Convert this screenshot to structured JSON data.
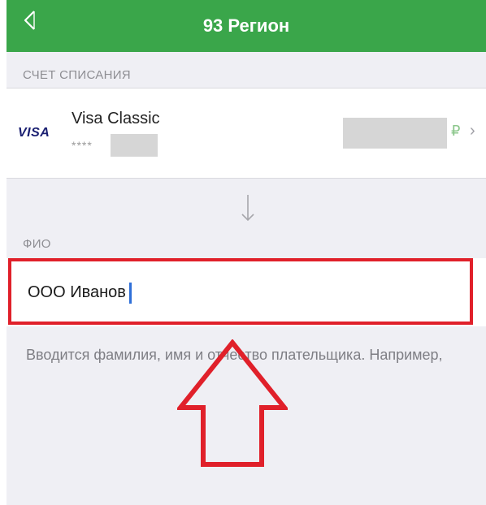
{
  "header": {
    "title": "93 Регион",
    "back_icon": "chevron-left-icon",
    "color": "#3aa64a"
  },
  "debit_section": {
    "label": "СЧЕТ СПИСАНИЯ",
    "card": {
      "brand": "VISA",
      "name": "Visa Classic",
      "mask": "****",
      "currency": "₽",
      "chevron": "›"
    }
  },
  "fio_section": {
    "label": "ФИО",
    "value": "ООО Иванов",
    "hint": "Вводится фамилия, имя и отчество плательщика. Например,"
  },
  "annotation": {
    "frame_color": "#e0202a",
    "arrow": "up-arrow-outline"
  }
}
